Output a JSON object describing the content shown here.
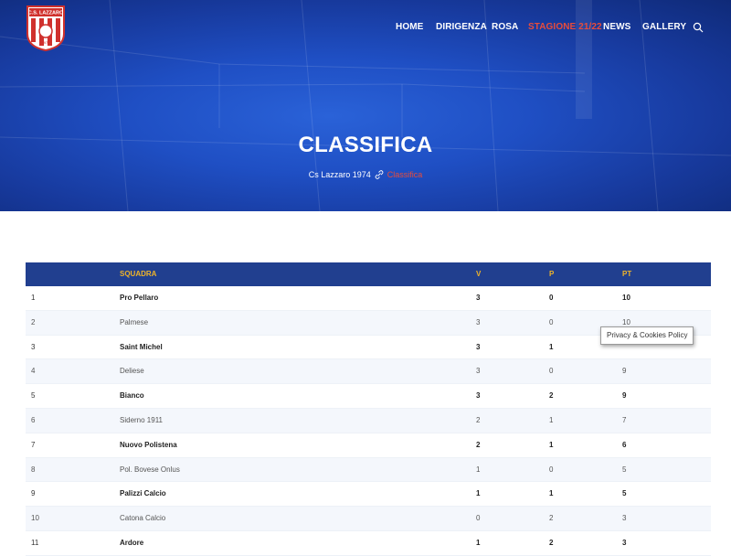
{
  "header": {
    "logo_text": "C.S. LAZZARO",
    "logo_year": "1974",
    "nav": [
      {
        "label": "HOME",
        "active": false
      },
      {
        "label": "DIRIGENZA",
        "active": false
      },
      {
        "label": "ROSA",
        "active": false
      },
      {
        "label": "STAGIONE 21/22",
        "active": true
      },
      {
        "label": "NEWS",
        "active": false
      },
      {
        "label": "GALLERY",
        "active": false
      }
    ],
    "search_icon": "search-icon"
  },
  "hero": {
    "title": "CLASSIFICA",
    "breadcrumb_home": "Cs Lazzaro 1974",
    "breadcrumb_current": "Classifica"
  },
  "table": {
    "headers": {
      "pos": "",
      "team": "SQUADRA",
      "v": "V",
      "p": "P",
      "pt": "PT"
    },
    "rows": [
      {
        "pos": "1",
        "team": "Pro Pellaro",
        "v": "3",
        "p": "0",
        "pt": "10"
      },
      {
        "pos": "2",
        "team": "Palmese",
        "v": "3",
        "p": "0",
        "pt": "10"
      },
      {
        "pos": "3",
        "team": "Saint Michel",
        "v": "3",
        "p": "1",
        "pt": ""
      },
      {
        "pos": "4",
        "team": "Deliese",
        "v": "3",
        "p": "0",
        "pt": "9"
      },
      {
        "pos": "5",
        "team": "Bianco",
        "v": "3",
        "p": "2",
        "pt": "9"
      },
      {
        "pos": "6",
        "team": "Siderno 1911",
        "v": "2",
        "p": "1",
        "pt": "7"
      },
      {
        "pos": "7",
        "team": "Nuovo Polistena",
        "v": "2",
        "p": "1",
        "pt": "6"
      },
      {
        "pos": "8",
        "team": "Pol. Bovese Onlus",
        "v": "1",
        "p": "0",
        "pt": "5"
      },
      {
        "pos": "9",
        "team": "Palizzi Calcio",
        "v": "1",
        "p": "1",
        "pt": "5"
      },
      {
        "pos": "10",
        "team": "Catona Calcio",
        "v": "0",
        "p": "2",
        "pt": "3"
      },
      {
        "pos": "11",
        "team": "Ardore",
        "v": "1",
        "p": "2",
        "pt": "3"
      }
    ]
  },
  "tooltip": {
    "text": "Privacy & Cookies Policy"
  },
  "colors": {
    "header_bg": "#213f8f",
    "header_text": "#f0b429",
    "accent": "#e74c3c",
    "hero": "#1f4fc4"
  }
}
